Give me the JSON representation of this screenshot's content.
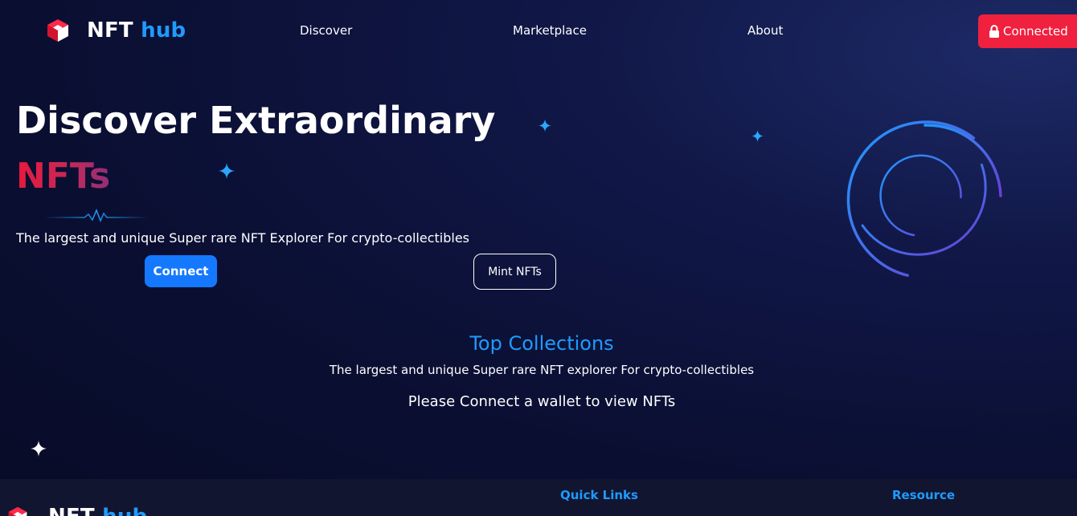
{
  "brand": {
    "name_primary": "NFT",
    "name_accent": "hub"
  },
  "nav": {
    "links": [
      "Discover",
      "Marketplace",
      "About"
    ],
    "connected_label": "Connected"
  },
  "hero": {
    "title": "Discover Extraordinary",
    "subtitle": "NFTs",
    "description": "The largest and unique Super rare NFT Explorer For crypto-collectibles",
    "connect_label": "Connect",
    "mint_label": "Mint NFTs"
  },
  "collections": {
    "title": "Top Collections",
    "description": "The largest and unique Super rare NFT explorer For crypto-collectibles",
    "empty_message": "Please Connect a wallet to view NFTs"
  },
  "footer": {
    "headings": [
      "Quick Links",
      "Resource"
    ]
  },
  "icons": {
    "logo": "cube-logo-icon",
    "lock": "lock-icon",
    "sparkle": "sparkle-icon",
    "rings": "orbit-rings-icon",
    "pulse": "heartbeat-line-icon"
  },
  "colors": {
    "accent_blue": "#1e9bff",
    "accent_red": "#f0203f",
    "button_blue": "#1479ff",
    "background": "#0b1035",
    "footer_bg": "#121530"
  }
}
